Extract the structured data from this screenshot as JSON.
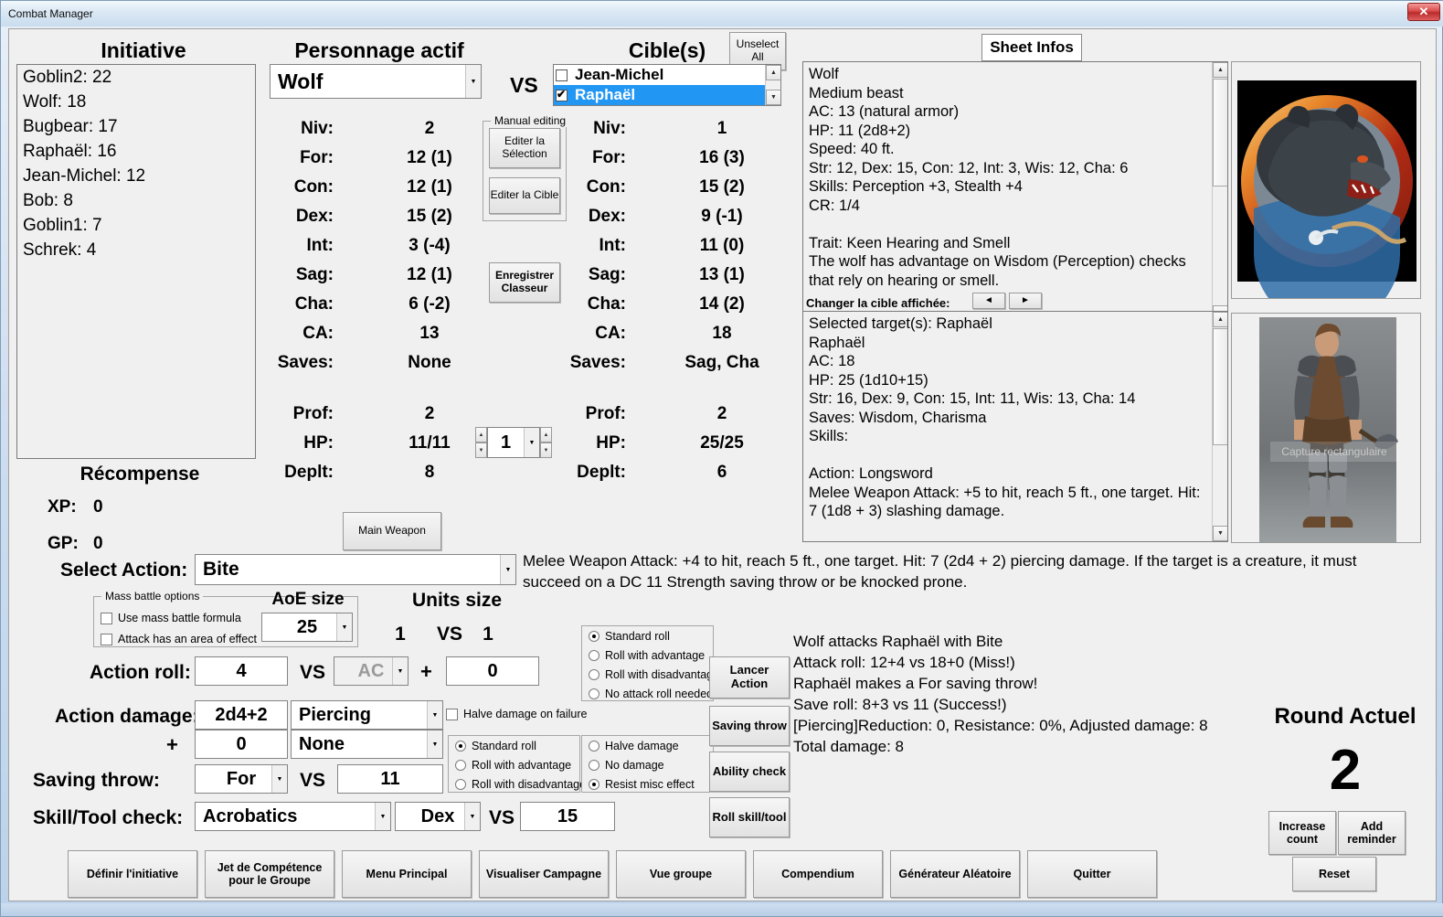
{
  "window": {
    "title": "Combat Manager",
    "close_label": "✕"
  },
  "initiative": {
    "heading": "Initiative",
    "entries": [
      "Goblin2: 22",
      "Wolf: 18",
      "Bugbear: 17",
      "Raphaël: 16",
      "Jean-Michel: 12",
      "Bob: 8",
      "Goblin1: 7",
      "Schrek: 4"
    ]
  },
  "reward": {
    "heading": "Récompense",
    "xp_label": "XP:",
    "xp_value": "0",
    "gp_label": "GP:",
    "gp_value": "0"
  },
  "active_character": {
    "heading": "Personnage actif",
    "name": "Wolf",
    "vs_label": "VS",
    "stats": [
      {
        "label": "Niv:",
        "value": "2"
      },
      {
        "label": "For:",
        "value": "12 (1)"
      },
      {
        "label": "Con:",
        "value": "12 (1)"
      },
      {
        "label": "Dex:",
        "value": "15 (2)"
      },
      {
        "label": "Int:",
        "value": "3 (-4)"
      },
      {
        "label": "Sag:",
        "value": "12 (1)"
      },
      {
        "label": "Cha:",
        "value": "6 (-2)"
      },
      {
        "label": "CA:",
        "value": "13"
      },
      {
        "label": "Saves:",
        "value": "None"
      }
    ],
    "stats2": [
      {
        "label": "Prof:",
        "value": "2"
      },
      {
        "label": "HP:",
        "value": "11/11"
      },
      {
        "label": "Deplt:",
        "value": "8"
      }
    ]
  },
  "target": {
    "heading": "Cible(s)",
    "unselect_all": "Unselect\nAll",
    "list": [
      {
        "name": "Jean-Michel",
        "checked": false,
        "selected": false
      },
      {
        "name": "Raphaël",
        "checked": true,
        "selected": true
      }
    ],
    "stats": [
      {
        "label": "Niv:",
        "value": "1"
      },
      {
        "label": "For:",
        "value": "16 (3)"
      },
      {
        "label": "Con:",
        "value": "15 (2)"
      },
      {
        "label": "Dex:",
        "value": "9 (-1)"
      },
      {
        "label": "Int:",
        "value": "11 (0)"
      },
      {
        "label": "Sag:",
        "value": "13 (1)"
      },
      {
        "label": "Cha:",
        "value": "14 (2)"
      },
      {
        "label": "CA:",
        "value": "18"
      },
      {
        "label": "Saves:",
        "value": "Sag, Cha"
      }
    ],
    "stats2": [
      {
        "label": "Prof:",
        "value": "2"
      },
      {
        "label": "HP:",
        "value": "25/25"
      },
      {
        "label": "Deplt:",
        "value": "6"
      }
    ]
  },
  "manual_editing": {
    "group_title": "Manual editing",
    "edit_selection": "Editer la\nSélection",
    "edit_target": "Editer la Cible",
    "save_workbook": "Enregistrer\nClasseur"
  },
  "hp_spinner": {
    "value": "1"
  },
  "main_weapon_button": "Main Weapon",
  "sheet": {
    "tab_label": "Sheet Infos",
    "active_text": "Wolf\nMedium beast\nAC: 13 (natural armor)\nHP: 11 (2d8+2)\nSpeed: 40 ft.\nStr: 12, Dex: 15, Con: 12, Int: 3, Wis: 12, Cha: 6\nSkills: Perception +3, Stealth +4\nCR: 1/4\n\nTrait: Keen Hearing and Smell\nThe wolf has advantage on Wisdom (Perception) checks that rely on hearing or smell.",
    "change_target_label": "Changer la cible affichée:",
    "prev_arrow": "◄",
    "next_arrow": "►",
    "target_text": "Selected target(s): Raphaël\nRaphaël\nAC: 18\nHP: 25 (1d10+15)\nStr: 16, Dex: 9, Con: 15, Int: 11, Wis: 13, Cha: 14\nSaves: Wisdom, Charisma\nSkills:\n\nAction: Longsword\nMelee Weapon Attack: +5 to hit, reach 5 ft., one target. Hit: 7 (1d8 + 3) slashing damage.\n\nAction: Light Crossbow"
  },
  "portrait_watermark": "Capture rectangulaire",
  "action": {
    "select_action_label": "Select Action:",
    "selected_action": "Bite",
    "description": "Melee Weapon Attack: +4 to hit, reach 5 ft., one target. Hit: 7 (2d4 + 2) piercing damage. If the target is a creature, it must succeed on a DC 11 Strength saving throw or be knocked prone.",
    "mass_battle": {
      "group_title": "Mass battle options",
      "use_formula_label": "Use mass battle formula",
      "use_formula_checked": false,
      "aoe_label": "Attack has an area of effect",
      "aoe_checked": false,
      "aoe_size_label": "AoE size",
      "aoe_size_value": "25"
    },
    "units_size_label": "Units size",
    "units_left": "1",
    "units_vs": "VS",
    "units_right": "1",
    "action_roll_label": "Action roll:",
    "action_roll_value": "4",
    "action_roll_vs": "VS",
    "action_roll_target": "AC",
    "action_roll_plus": "+",
    "action_roll_bonus": "0",
    "action_damage_label": "Action damage:",
    "damage_dice": "2d4+2",
    "damage_type": "Piercing",
    "damage_plus": "+",
    "damage_dice2": "0",
    "damage_type2": "None",
    "saving_throw_label": "Saving throw:",
    "saving_ability": "For",
    "saving_vs": "VS",
    "saving_dc": "11",
    "skill_label": "Skill/Tool check:",
    "skill_name": "Acrobatics",
    "skill_ability": "Dex",
    "skill_vs": "VS",
    "skill_dc": "15",
    "halve_damage_on_failure": "Halve damage on failure",
    "halve_damage_on_failure_checked": false
  },
  "attack_roll_options": {
    "options": [
      "Standard roll",
      "Roll with advantage",
      "Roll with disadvantage",
      "No attack roll needed"
    ],
    "selected_index": 0
  },
  "save_roll_options": {
    "options": [
      "Standard roll",
      "Roll with advantage",
      "Roll with disadvantage"
    ],
    "selected_index": 0
  },
  "save_effect_options": {
    "options": [
      "Halve damage",
      "No damage",
      "Resist misc effect"
    ],
    "selected_index": 2
  },
  "roll_buttons": {
    "launch_action": "Lancer\nAction",
    "saving_throw": "Saving throw",
    "ability_check": "Ability check",
    "roll_skill_tool": "Roll skill/tool"
  },
  "log": {
    "lines": [
      "Wolf attacks Raphaël with Bite",
      "Attack roll: 12+4 vs 18+0 (Miss!)",
      "Raphaël makes a For saving throw!",
      "Save roll: 8+3 vs 11 (Success!)",
      "[Piercing]Reduction: 0, Resistance: 0%, Adjusted damage: 8",
      "Total damage: 8"
    ]
  },
  "round": {
    "label": "Round Actuel",
    "number": "2",
    "increase_count": "Increase\ncount",
    "add_reminder": "Add\nreminder",
    "reset": "Reset"
  },
  "bottom_buttons": [
    "Définir l'initiative",
    "Jet de Compétence\npour le Groupe",
    "Menu Principal",
    "Visualiser Campagne",
    "Vue groupe",
    "Compendium",
    "Générateur Aléatoire",
    "Quitter"
  ],
  "colors": {
    "selection_blue": "#2196f3",
    "window_bg": "#f0f0f0",
    "title_gradient_top": "#f2f7fc",
    "close_red": "#d94b4b"
  }
}
